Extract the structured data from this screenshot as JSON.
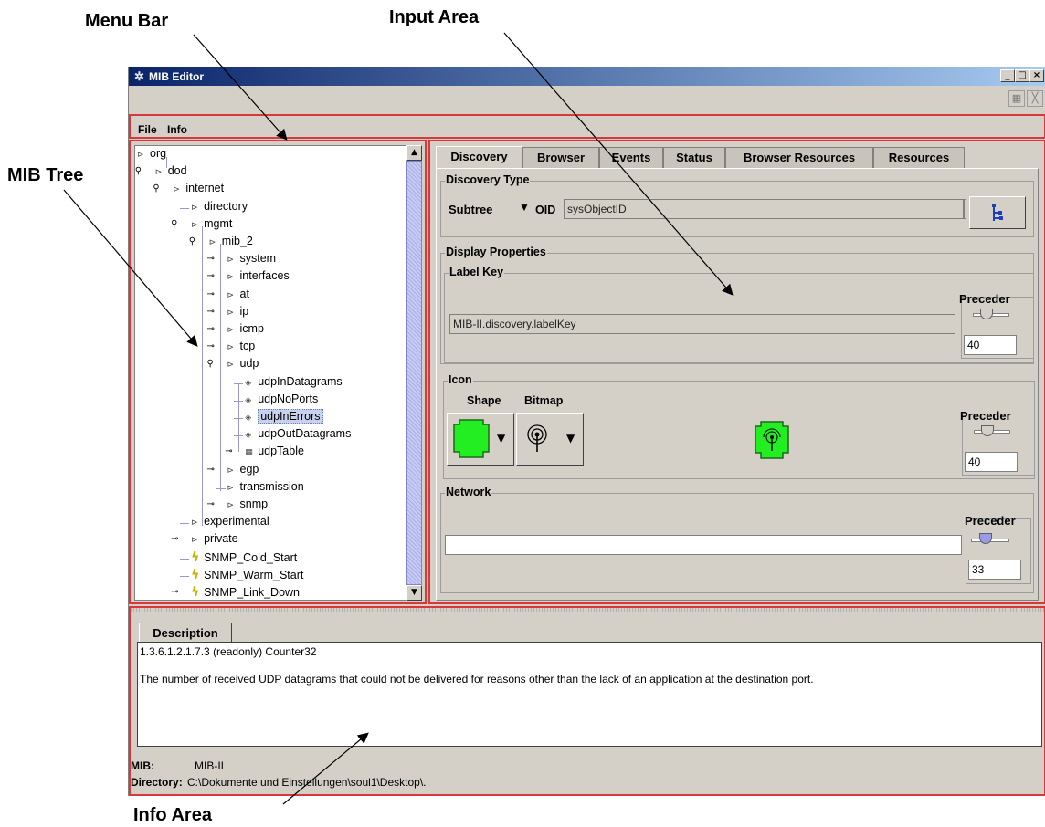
{
  "callouts": {
    "menu_bar": "Menu Bar",
    "input_area": "Input Area",
    "mib_tree": "MIB Tree",
    "info_area": "Info Area"
  },
  "window": {
    "title": "MIB Editor",
    "buttons": [
      "_",
      "□",
      "×"
    ]
  },
  "menu": [
    "File",
    "Info"
  ],
  "tree": {
    "nodes": [
      {
        "label": "org",
        "icon": "branch-icon"
      },
      {
        "label": "dod",
        "icon": "branch-icon"
      },
      {
        "label": "internet",
        "icon": "branch-icon"
      },
      {
        "label": "directory",
        "icon": "branch-icon"
      },
      {
        "label": "mgmt",
        "icon": "branch-icon"
      },
      {
        "label": "mib_2",
        "icon": "branch-icon"
      },
      {
        "label": "system",
        "icon": "branch-icon"
      },
      {
        "label": "interfaces",
        "icon": "branch-icon"
      },
      {
        "label": "at",
        "icon": "branch-icon"
      },
      {
        "label": "ip",
        "icon": "branch-icon"
      },
      {
        "label": "icmp",
        "icon": "branch-icon"
      },
      {
        "label": "tcp",
        "icon": "branch-icon"
      },
      {
        "label": "udp",
        "icon": "branch-icon"
      },
      {
        "label": "udpInDatagrams",
        "icon": "leaf-diamond-icon"
      },
      {
        "label": "udpNoPorts",
        "icon": "leaf-diamond-icon"
      },
      {
        "label": "udpInErrors",
        "icon": "leaf-diamond-icon",
        "selected": true
      },
      {
        "label": "udpOutDatagrams",
        "icon": "leaf-diamond-icon"
      },
      {
        "label": "udpTable",
        "icon": "table-icon"
      },
      {
        "label": "egp",
        "icon": "branch-icon"
      },
      {
        "label": "transmission",
        "icon": "branch-icon"
      },
      {
        "label": "snmp",
        "icon": "branch-icon"
      },
      {
        "label": "experimental",
        "icon": "branch-icon"
      },
      {
        "label": "private",
        "icon": "branch-icon"
      },
      {
        "label": "SNMP_Cold_Start",
        "icon": "trap-icon"
      },
      {
        "label": "SNMP_Warm_Start",
        "icon": "trap-icon"
      },
      {
        "label": "SNMP_Link_Down",
        "icon": "trap-icon"
      }
    ]
  },
  "tabs": [
    "Discovery",
    "Browser",
    "Events",
    "Status",
    "Browser Resources",
    "Resources"
  ],
  "active_tab": "Discovery",
  "discovery": {
    "group_label": "Discovery Type",
    "type_value": "Subtree",
    "oid_label": "OID",
    "oid_value": "sysObjectID"
  },
  "display": {
    "group_label": "Display Properties",
    "label_key": {
      "group_label": "Label Key",
      "value": "MIB-II.discovery.labelKey",
      "preceder_label": "Preceder",
      "preceder_value": "40"
    },
    "icon": {
      "group_label": "Icon",
      "shape_label": "Shape",
      "bitmap_label": "Bitmap",
      "preceder_label": "Preceder",
      "preceder_value": "40",
      "shape_color": "#22ee22"
    },
    "network": {
      "group_label": "Network",
      "value": "",
      "preceder_label": "Preceder",
      "preceder_value": "33"
    }
  },
  "description": {
    "tab_label": "Description",
    "line1": "1.3.6.1.2.1.7.3 (readonly) Counter32",
    "line2": "The number of received UDP datagrams that could not be delivered for reasons other than the lack of an application at the destination port."
  },
  "info": {
    "mib_label": "MIB:",
    "mib_value": "MIB-II",
    "dir_label": "Directory:",
    "dir_value": "C:\\Dokumente und Einstellungen\\soul1\\Desktop\\."
  },
  "colors": {
    "highlight_border": "#d9383a",
    "selection": "#c8d2ee",
    "title_gradient_start": "#0a246a"
  }
}
